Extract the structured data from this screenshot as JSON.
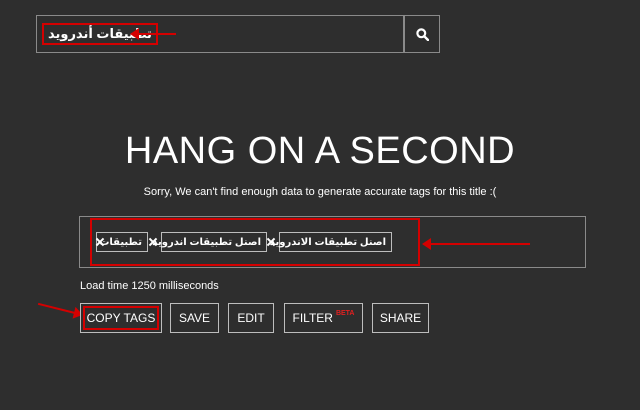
{
  "search": {
    "value": "تطبيقات أندرويد"
  },
  "result": {
    "title": "HANG ON A SECOND",
    "message": "Sorry, We can't find enough data to generate accurate tags for this title :("
  },
  "tags": [
    {
      "label": "تطبيقات"
    },
    {
      "label": "اصنل تطبيقات اندرويد"
    },
    {
      "label": "اصنل تطبيقات الاندرويد"
    }
  ],
  "load_time": "Load time 1250 milliseconds",
  "actions": {
    "copy_tags": "COPY TAGS",
    "save": "SAVE",
    "edit": "EDIT",
    "filter": "FILTER",
    "filter_badge": "BETA",
    "share": "SHARE"
  },
  "colors": {
    "background": "#2e2e2e",
    "annotation": "#d40000",
    "beta_badge": "#e02020"
  }
}
